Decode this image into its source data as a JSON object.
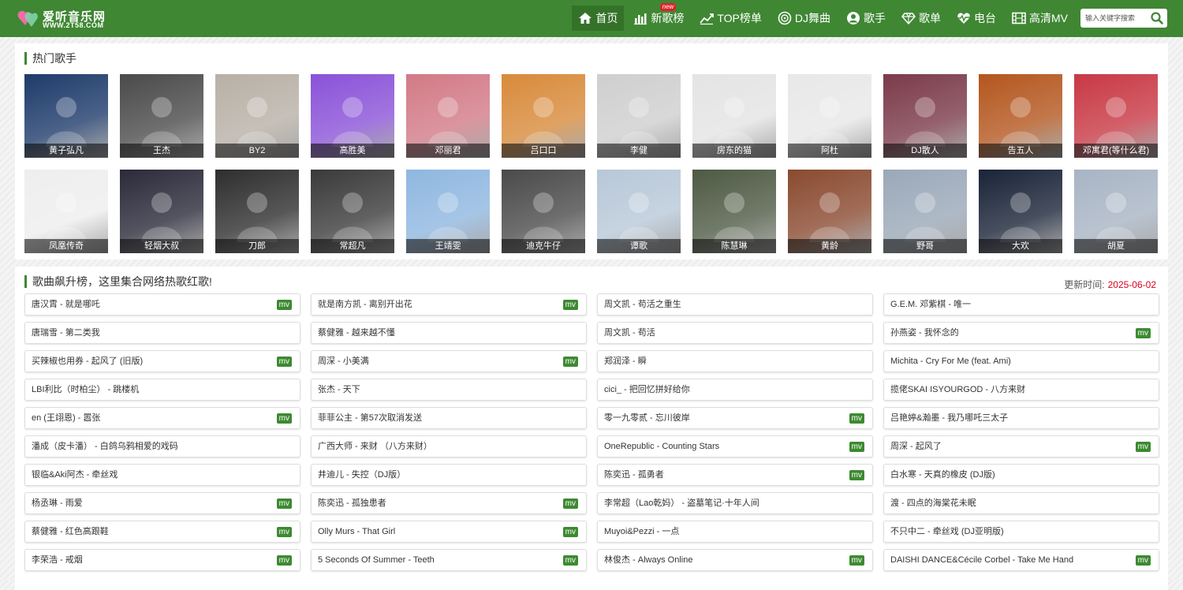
{
  "header": {
    "logo_title": "爱听音乐网",
    "logo_subtitle": "WWW.2T58.COM",
    "search_placeholder": "输入关键字搜索",
    "nav": [
      {
        "label": "首页",
        "icon": "home-icon",
        "active": true
      },
      {
        "label": "新歌榜",
        "icon": "bar-chart-icon",
        "badge": "new"
      },
      {
        "label": "TOP榜单",
        "icon": "trend-line-icon"
      },
      {
        "label": "DJ舞曲",
        "icon": "disc-icon"
      },
      {
        "label": "歌手",
        "icon": "user-circle-icon"
      },
      {
        "label": "歌单",
        "icon": "diamond-icon"
      },
      {
        "label": "电台",
        "icon": "heartbeat-icon"
      },
      {
        "label": "高清MV",
        "icon": "film-icon"
      }
    ]
  },
  "artists_section": {
    "title": "热门歌手",
    "artists": [
      {
        "name": "黄子弘凡",
        "bg": "#1e3b6b"
      },
      {
        "name": "王杰",
        "bg": "#4a4a4a"
      },
      {
        "name": "BY2",
        "bg": "#b8b0a6"
      },
      {
        "name": "高胜美",
        "bg": "#8a52d8"
      },
      {
        "name": "邓丽君",
        "bg": "#d27a86"
      },
      {
        "name": "吕口口",
        "bg": "#d88a3a"
      },
      {
        "name": "李健",
        "bg": "#cfcfcf"
      },
      {
        "name": "房东的猫",
        "bg": "#e4e4e4"
      },
      {
        "name": "阿杜",
        "bg": "#e8e8e8"
      },
      {
        "name": "DJ散人",
        "bg": "#7b3a4a"
      },
      {
        "name": "告五人",
        "bg": "#b4561e"
      },
      {
        "name": "邓寓君(等什么君)",
        "bg": "#c83844"
      },
      {
        "name": "凤凰传奇",
        "bg": "#eeeeee"
      },
      {
        "name": "轻烟大叔",
        "bg": "#2a2a3a"
      },
      {
        "name": "刀郎",
        "bg": "#2e2e2e"
      },
      {
        "name": "常超凡",
        "bg": "#3a3a3a"
      },
      {
        "name": "王靖雯",
        "bg": "#8fb7e0"
      },
      {
        "name": "迪克牛仔",
        "bg": "#4a4a4a"
      },
      {
        "name": "谭歌",
        "bg": "#b8c8d8"
      },
      {
        "name": "陈慧琳",
        "bg": "#4e5a44"
      },
      {
        "name": "黄龄",
        "bg": "#8a4a30"
      },
      {
        "name": "野哥",
        "bg": "#9aa8b8"
      },
      {
        "name": "大欢",
        "bg": "#1a2438"
      },
      {
        "name": "胡夏",
        "bg": "#a8b4c4"
      }
    ]
  },
  "songs_section": {
    "title": "歌曲飙升榜，这里集合网络热歌红歌!",
    "update_label": "更新时间:",
    "update_date": "2025-06-02",
    "mv_label": "mv",
    "songs": [
      {
        "title": "唐汉霄 - 就是哪吒",
        "mv": true
      },
      {
        "title": "就是南方凯 - 离别开出花",
        "mv": true
      },
      {
        "title": "周文凯 - 苟活之重生",
        "mv": false
      },
      {
        "title": "G.E.M. 邓紫棋 - 唯一",
        "mv": false
      },
      {
        "title": "唐瑞雪 - 第二类我",
        "mv": false
      },
      {
        "title": "蔡健雅 - 越来越不懂",
        "mv": false
      },
      {
        "title": "周文凯 - 苟活",
        "mv": false
      },
      {
        "title": "孙燕姿 - 我怀念的",
        "mv": true
      },
      {
        "title": "买辣椒也用券 - 起风了 (旧版)",
        "mv": true
      },
      {
        "title": "周深 - 小美满",
        "mv": true
      },
      {
        "title": "郑润泽 - 瞬",
        "mv": false
      },
      {
        "title": "Michita - Cry For Me (feat. Ami)",
        "mv": false
      },
      {
        "title": "LBI利比（时柏尘） - 跳楼机",
        "mv": false
      },
      {
        "title": "张杰 - 天下",
        "mv": false
      },
      {
        "title": "cici_ - 把回忆拼好给你",
        "mv": false
      },
      {
        "title": "揽佬SKAI ISYOURGOD - 八方来财",
        "mv": false
      },
      {
        "title": "en (王翊恩) - 嚣张",
        "mv": true
      },
      {
        "title": "菲菲公主 - 第57次取消发送",
        "mv": false
      },
      {
        "title": "零一九零贰 - 忘川彼岸",
        "mv": true
      },
      {
        "title": "吕艳婷&瀚墨 - 我乃哪吒三太子",
        "mv": false
      },
      {
        "title": "潘成（皮卡潘） - 白鸽乌鸦相爱的戏码",
        "mv": false
      },
      {
        "title": "广西大师 - 来财 （八方来财）",
        "mv": false
      },
      {
        "title": "OneRepublic - Counting Stars",
        "mv": true
      },
      {
        "title": "周深 - 起风了",
        "mv": true
      },
      {
        "title": "银临&Aki阿杰 - 牵丝戏",
        "mv": false
      },
      {
        "title": "井迪儿 - 失控（DJ版）",
        "mv": false
      },
      {
        "title": "陈奕迅 - 孤勇者",
        "mv": true
      },
      {
        "title": "白水寒 - 天真的橡皮 (DJ版)",
        "mv": false
      },
      {
        "title": "杨丞琳 - 雨爱",
        "mv": true
      },
      {
        "title": "陈奕迅 - 孤独患者",
        "mv": true
      },
      {
        "title": "李常超（Lao乾妈） - 盗墓笔记·十年人间",
        "mv": false
      },
      {
        "title": "渡 - 四点的海棠花未眠",
        "mv": false
      },
      {
        "title": "蔡健雅 - 红色高跟鞋",
        "mv": true
      },
      {
        "title": "Olly Murs - That Girl",
        "mv": true
      },
      {
        "title": "Muyoi&Pezzi - 一点",
        "mv": false
      },
      {
        "title": "不只中二 - 牵丝戏 (DJ亚明版)",
        "mv": false
      },
      {
        "title": "李荣浩 - 戒烟",
        "mv": true
      },
      {
        "title": "5 Seconds Of Summer - Teeth",
        "mv": true
      },
      {
        "title": "林俊杰 - Always Online",
        "mv": true
      },
      {
        "title": "DAISHI DANCE&Cécile Corbel - Take Me Hand",
        "mv": true
      }
    ]
  },
  "colors": {
    "brand_green": "#3f8733",
    "badge_red": "#e0202a",
    "date_red": "#d9001b"
  }
}
